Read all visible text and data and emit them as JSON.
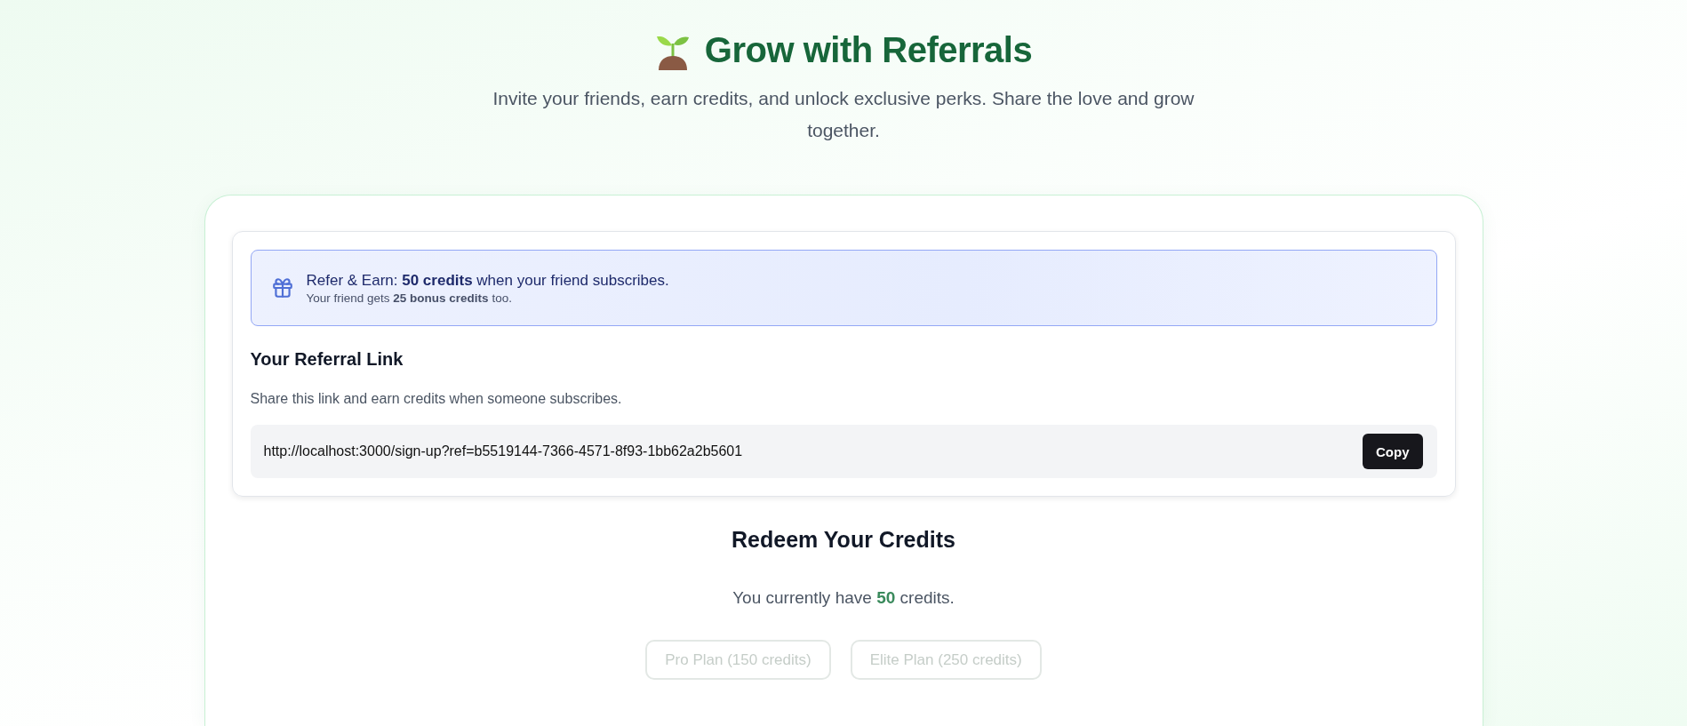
{
  "header": {
    "title": "Grow with Referrals",
    "subtitle": "Invite your friends, earn credits, and unlock exclusive perks. Share the love and grow together."
  },
  "banner": {
    "headline": "Refer & Earn: **50 credits** when your friend subscribes.",
    "detail": "Your friend gets **25 bonus credits** too."
  },
  "referral": {
    "heading": "Your Referral Link",
    "description": "Share this link and earn credits when someone subscribes.",
    "link": "http://localhost:3000/sign-up?ref=b5519144-7366-4571-8f93-1bb62a2b5601",
    "copy_button": "Copy"
  },
  "redeem": {
    "heading": "Redeem Your Credits",
    "balance": "You currently have **50** credits.",
    "plans": [
      {
        "label": "Pro Plan (150 credits)",
        "disabled": true
      },
      {
        "label": "Elite Plan (250 credits)",
        "disabled": true
      }
    ]
  }
}
